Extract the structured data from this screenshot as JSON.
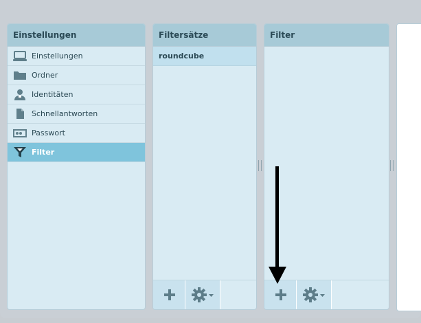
{
  "settings_panel": {
    "title": "Einstellungen",
    "items": [
      {
        "label": "Einstellungen",
        "icon": "laptop-icon"
      },
      {
        "label": "Ordner",
        "icon": "folder-icon"
      },
      {
        "label": "Identitäten",
        "icon": "person-icon"
      },
      {
        "label": "Schnellantworten",
        "icon": "document-icon"
      },
      {
        "label": "Passwort",
        "icon": "password-icon"
      },
      {
        "label": "Filter",
        "icon": "filter-icon",
        "selected": true
      }
    ]
  },
  "filtersets_panel": {
    "title": "Filtersätze",
    "items": [
      "roundcube"
    ],
    "footer": {
      "add_icon": "plus-icon",
      "settings_icon": "gear-dropdown-icon"
    }
  },
  "filter_panel": {
    "title": "Filter",
    "footer": {
      "add_icon": "plus-icon",
      "settings_icon": "gear-dropdown-icon"
    }
  },
  "annotation": {
    "type": "arrow-down",
    "target": "filter add button"
  },
  "colors": {
    "header_bg": "#a7cad7",
    "panel_bg": "#d9ebf3",
    "selected_bg": "#7fc4dc",
    "icon": "#5f7f8b"
  }
}
